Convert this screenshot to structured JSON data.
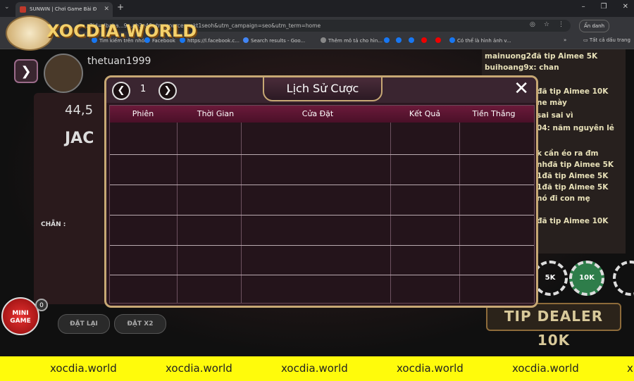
{
  "browser": {
    "tab_title": "SUNWIN | Chơi Game Bài Đ",
    "url": "...2id=dbaba...9...ab3e4&utm_source=mkt1seoh&utm_campaign=seo&utm_term=home",
    "hide_button": "Ẩn danh",
    "bookmarks": [
      {
        "label": "Tim kiếm trên nhóm"
      },
      {
        "label": "Facebook"
      },
      {
        "label": "https://l.facebook.c..."
      },
      {
        "label": "Search results - Goo..."
      },
      {
        "label": "Thêm mô tả cho hìn..."
      },
      {
        "label": "Có thể là hình ảnh v..."
      },
      {
        "label": "Tất cả dấu trang"
      }
    ]
  },
  "watermark": {
    "text": "XOCDIA.WORLD"
  },
  "game": {
    "username": "thetuan1999",
    "balance_partial": "44,5",
    "jackpot_partial": "JAC",
    "bet_label": "CHẴN :",
    "buttons": {
      "reset": "ĐẶT LẠI",
      "double": "ĐẶT X2"
    },
    "mini_game": {
      "label": "MINI GAME",
      "count": "0"
    },
    "tip_dealer": "TIP DEALER 10K",
    "chips": [
      "5K",
      "10K"
    ],
    "chat": [
      {
        "user": "mainuong2",
        "text": "đã tip Aimee 5K"
      },
      {
        "user": "buihoang9x:",
        "text": "chan"
      },
      {
        "user": "",
        "text": "đã tip Aimee 10K"
      },
      {
        "user": "",
        "text": "ne mày"
      },
      {
        "user": "",
        "text": "sai sai vì"
      },
      {
        "user": "04:",
        "text": "năm nguyên lẻ"
      },
      {
        "user": "",
        "text": "k cần éo ra đm"
      },
      {
        "user": "nh",
        "text": "đã tip Aimee 5K"
      },
      {
        "user": "1",
        "text": "đã tip Aimee 5K"
      },
      {
        "user": "1",
        "text": "đã tip Aimee 5K"
      },
      {
        "user": "",
        "text": "nó đi con mẹ"
      },
      {
        "user": "",
        "text": "đã tip Aimee 10K"
      }
    ]
  },
  "modal": {
    "title": "Lịch Sử Cược",
    "page": "1",
    "columns": [
      "Phiên",
      "Thời Gian",
      "Cửa Đặt",
      "Kết Quả",
      "Tiền Thắng"
    ]
  },
  "banner": {
    "items": [
      "xocdia.world",
      "xocdia.world",
      "xocdia.world",
      "xocdia.world",
      "xocdia.world",
      "x"
    ]
  }
}
